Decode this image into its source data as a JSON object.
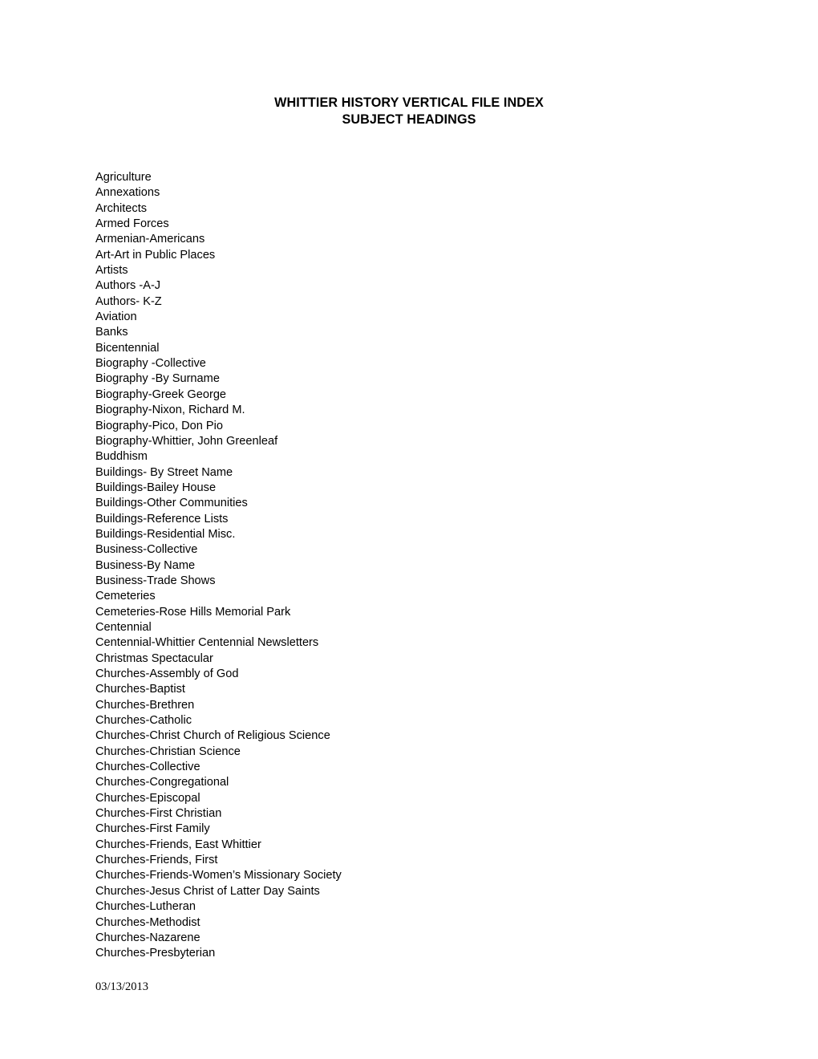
{
  "document": {
    "title_lines": [
      "WHITTIER HISTORY VERTICAL FILE INDEX",
      "SUBJECT HEADINGS"
    ],
    "title_line_1": "WHITTIER HISTORY VERTICAL FILE INDEX",
    "title_line_2": "SUBJECT HEADINGS",
    "footer_date": "03/13/2013",
    "text_color": "#000000",
    "background_color": "#ffffff"
  },
  "subject_headings": [
    "Agriculture",
    "Annexations",
    "Architects",
    "Armed Forces",
    "Armenian-Americans",
    "Art-Art in Public Places",
    "Artists",
    "Authors -A-J",
    "Authors- K-Z",
    "Aviation",
    "Banks",
    "Bicentennial",
    "Biography -Collective",
    "Biography -By Surname",
    "Biography-Greek George",
    "Biography-Nixon, Richard M.",
    "Biography-Pico, Don Pio",
    "Biography-Whittier, John Greenleaf",
    "Buddhism",
    "Buildings- By Street Name",
    "Buildings-Bailey House",
    "Buildings-Other Communities",
    "Buildings-Reference Lists",
    "Buildings-Residential Misc.",
    "Business-Collective",
    "Business-By Name",
    "Business-Trade Shows",
    "Cemeteries",
    "Cemeteries-Rose Hills Memorial Park",
    "Centennial",
    "Centennial-Whittier Centennial Newsletters",
    "Christmas Spectacular",
    "Churches-Assembly of God",
    "Churches-Baptist",
    "Churches-Brethren",
    "Churches-Catholic",
    "Churches-Christ Church of Religious Science",
    "Churches-Christian Science",
    "Churches-Collective",
    "Churches-Congregational",
    "Churches-Episcopal",
    "Churches-First Christian",
    "Churches-First Family",
    "Churches-Friends, East Whittier",
    "Churches-Friends, First",
    "Churches-Friends-Women’s Missionary Society",
    "Churches-Jesus Christ of Latter Day Saints",
    "Churches-Lutheran",
    "Churches-Methodist",
    "Churches-Nazarene",
    "Churches-Presbyterian"
  ]
}
